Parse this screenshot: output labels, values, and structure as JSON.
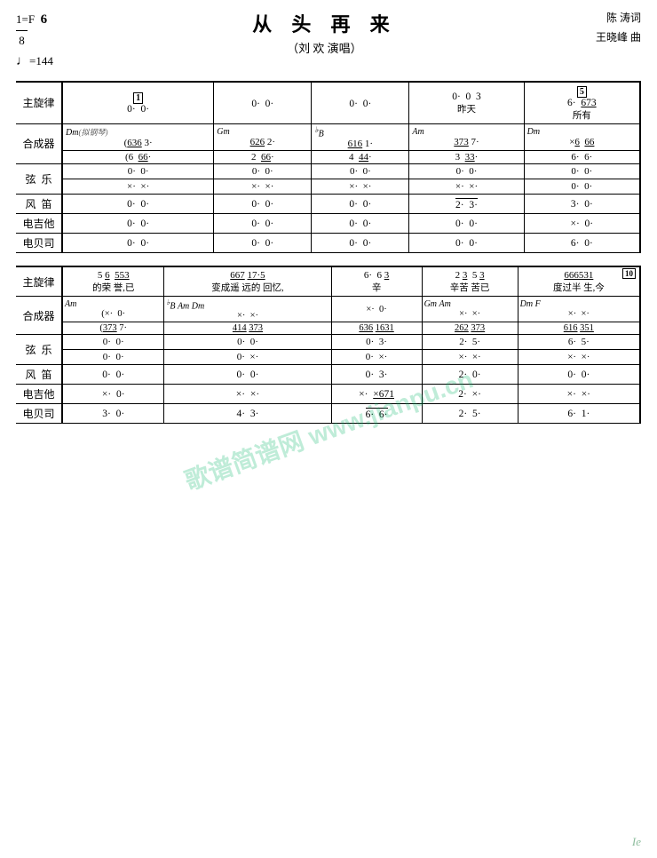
{
  "header": {
    "key": "1=F",
    "time": "6/8",
    "tempo_symbol": "♩",
    "tempo_value": "=144",
    "title": "从 头 再 来",
    "subtitle": "（刘  欢 演唱）",
    "lyricist": "陈  涛词",
    "composer": "王晓峰 曲"
  },
  "watermark": "歌谱简谱网 www.jianpu.cn",
  "section1": {
    "rehearsal_marks": [
      "1",
      "5"
    ],
    "rows": [
      {
        "label": "主旋律",
        "measures": [
          {
            "content": "0·  0·",
            "mark": "1"
          },
          {
            "content": "0·  0·"
          },
          {
            "content": "0·  0·"
          },
          {
            "content": "0·  0  3"
          },
          {
            "content": "6·  6̲7̲3̲",
            "mark": "5"
          }
        ],
        "lyrics": [
          "",
          "",
          "",
          "昨天",
          "所有"
        ]
      },
      {
        "label": "合成器",
        "sub_note": "(拟钢琴)",
        "upper_measures": [
          {
            "content": "(6̲3̲6̲  3·",
            "chord": "Dm",
            "mark": "1"
          },
          {
            "content": "6̲2̲6̲  2·",
            "chord": "Gm"
          },
          {
            "content": "6̲1̲6̲  1·",
            "chord": "♭B"
          },
          {
            "content": "3̲7̲3̲  7·",
            "chord": "Am"
          },
          {
            "content": "×6̲  6̲6̲",
            "chord": "Dm"
          }
        ],
        "lower_measures": [
          {
            "content": "(6  6̲6̲·"
          },
          {
            "content": "2  6̲6̲·"
          },
          {
            "content": "4  4̲4̲·"
          },
          {
            "content": "3  3̲3̲·"
          },
          {
            "content": "6·  6·"
          }
        ]
      },
      {
        "label": "弦  乐",
        "upper_measures": [
          {
            "content": "0·  0·"
          },
          {
            "content": "0·  0·"
          },
          {
            "content": "0·  0·"
          },
          {
            "content": "0·  0·"
          },
          {
            "content": "0·  0·"
          }
        ],
        "lower_measures": [
          {
            "content": "×·  ×·"
          },
          {
            "content": "×·  ×·"
          },
          {
            "content": "×·  ×·"
          },
          {
            "content": "×·  ×·"
          },
          {
            "content": "0·  0·"
          }
        ]
      },
      {
        "label": "风  笛",
        "measures": [
          {
            "content": "0·  0·"
          },
          {
            "content": "0·  0·"
          },
          {
            "content": "0·  0·"
          },
          {
            "content": "2·  3·"
          },
          {
            "content": "3·  0·"
          }
        ]
      },
      {
        "label": "电吉他",
        "measures": [
          {
            "content": "0·  0·"
          },
          {
            "content": "0·  0·"
          },
          {
            "content": "0·  0·"
          },
          {
            "content": "0·  0·"
          },
          {
            "content": "×·  0·"
          }
        ]
      },
      {
        "label": "电贝司",
        "measures": [
          {
            "content": "0·  0·"
          },
          {
            "content": "0·  0·"
          },
          {
            "content": "0·  0·"
          },
          {
            "content": "0·  0·"
          },
          {
            "content": "6·  0·"
          }
        ]
      }
    ]
  },
  "section2": {
    "rehearsal_marks": [
      "10"
    ],
    "rows": [
      {
        "label": "主旋律",
        "measures": [
          {
            "content": "5 6̲  5̲5̲3̲"
          },
          {
            "content": "6̲6̲7̲  1̲7̲·5̲"
          },
          {
            "content": "6·  6 3̲"
          },
          {
            "content": "2 3̲  5 3̲"
          },
          {
            "content": "6̲6̲6̲5̲3̲1̲",
            "mark": "10"
          }
        ],
        "lyrics": [
          "的荣  誉,已",
          "变成遥  远的  回忆,",
          "辛",
          "辛苦  苦已",
          "度过半  生,今"
        ]
      },
      {
        "label": "合成器",
        "upper_measures": [
          {
            "content": "(×·  0·",
            "chord": "Am"
          },
          {
            "content": "×·  ×·",
            "chord": "♭B  Am  Dm"
          },
          {
            "content": "×·  0·"
          },
          {
            "content": "×·  ×·",
            "chord": "Gm  Am"
          },
          {
            "content": "×·  ×·",
            "chord": "Dm  F"
          }
        ],
        "lower_measures": [
          {
            "content": "(3̲7̲3̲  7·"
          },
          {
            "content": "4̲1̲4̲  3̲7̲3̲"
          },
          {
            "content": "6̲3̲6̲  1̲6̲3̲1̲"
          },
          {
            "content": "2̲6̲2̲  3̲7̲3̲"
          },
          {
            "content": "6̲1̲6̲  3̲5̲1̲"
          }
        ]
      },
      {
        "label": "弦  乐",
        "upper_measures": [
          {
            "content": "0·  0·"
          },
          {
            "content": "0·  0·"
          },
          {
            "content": "0·  3·"
          },
          {
            "content": "2·  5·"
          },
          {
            "content": "6·  5·"
          }
        ],
        "lower_measures": [
          {
            "content": "0·  0·"
          },
          {
            "content": "0·  ×·"
          },
          {
            "content": "0·  ×·"
          },
          {
            "content": "×·  ×·"
          },
          {
            "content": "×·  ×·"
          }
        ]
      },
      {
        "label": "风  笛",
        "measures": [
          {
            "content": "0·  0·"
          },
          {
            "content": "0·  0·"
          },
          {
            "content": "0·  3·"
          },
          {
            "content": "2·  0·"
          },
          {
            "content": "0·  0·"
          }
        ]
      },
      {
        "label": "电吉他",
        "measures": [
          {
            "content": "×·  0·"
          },
          {
            "content": "×·  ×·"
          },
          {
            "content": "×·  ×̲6̲7̲1̲"
          },
          {
            "content": "2·  ×·"
          },
          {
            "content": "×·  ×·"
          }
        ]
      },
      {
        "label": "电贝司",
        "measures": [
          {
            "content": "3·  0·"
          },
          {
            "content": "4·  3·"
          },
          {
            "content": "6·  6·"
          },
          {
            "content": "2·  5·"
          },
          {
            "content": "6·  1·"
          }
        ]
      }
    ]
  }
}
